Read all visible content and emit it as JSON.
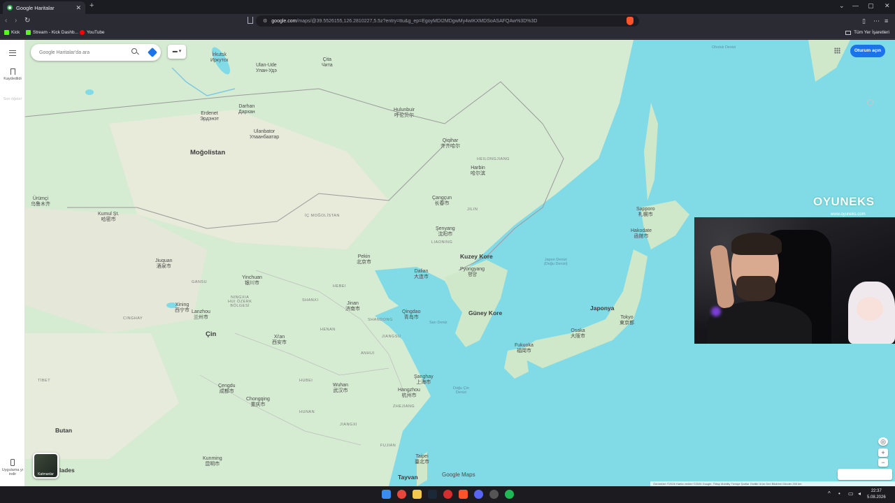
{
  "browser": {
    "tab_title": "Google Haritalar",
    "tab_close": "✕",
    "new_tab": "+",
    "url_host": "google.com",
    "url_rest": "/maps/@39.5526155,126.2810227,5.5z?entry=ttu&g_ep=EgoyMDI2MDgwMy4wIKXMDSoASAFQAw%3D%3D",
    "window_controls": [
      "⌄",
      "—",
      "▢",
      "✕"
    ],
    "bookmarks": [
      {
        "label": "Kick",
        "color": "#53fc18"
      },
      {
        "label": "Stream - Kick Dashb...",
        "color": "#53fc18"
      },
      {
        "label": "YouTube",
        "color": "#ff0000"
      }
    ],
    "all_bookmarks": "Tüm Yer İşaretleri"
  },
  "maps": {
    "search_placeholder": "Google Haritalar'da ara",
    "sign_in": "Oturum açın",
    "rail": {
      "saved": "Kaydedildi",
      "recent": "Son öğeler",
      "get_app": "Uygulama yı indir"
    },
    "layers_label": "Katmanlar",
    "logo": "Google Maps",
    "footer": "Görüntüler ©2026  Harita verileri ©2026 Google, TMap Mobility   Türkiye   Şartlar   Gizlilik   Ürün Geri Bildirimi Gönder   200 km",
    "labels": {
      "irkutsk": "İrkutsk\nИркутск",
      "ulanude": "Ulan-Ude\nУлан-Удэ",
      "chita": "Çita\nЧита",
      "hulunbuir": "Hulunbuir\n呼伦贝尔",
      "qiqihar": "Qiqihar\n齐齐哈尔",
      "harbin": "Harbin\n哈尔滨",
      "heilongjiang": "HEILONGJIANG",
      "ulaanbaatar": "Ulanbator\nУлаанбаатар",
      "mogolistan": "Moğolistan",
      "erdenet": "Erdenet\nЭрдэнэт",
      "darkhan": "Darhan\nДархан",
      "urumqi": "Ürümçi\n乌鲁木齐",
      "kumul": "Kumul Şt.\n哈密市",
      "ic_mogolistan": "İÇ MOĞOLİSTAN",
      "changchun": "Çangçun\n长春市",
      "jilin": "JILIN",
      "shenyang": "Şenyang\n沈阳市",
      "liaoning": "LIAONING",
      "kuzey_kore": "Kuzey Kore",
      "pyongyang": "Pyongyang\n평양",
      "pekin": "Pekin\n北京市",
      "dalian": "Dalian\n大连市",
      "yinchuan": "Yinchuan\n银川市",
      "jiuquan": "Jiuquan\n酒泉市",
      "gansu": "GANSU",
      "ningxia": "NINGXIA\nHUI ÖZERK\nBÖLGESİ",
      "shanxi": "SHANXI",
      "hebei": "HEBEI",
      "jinan": "Jinan\n济南市",
      "qingdao": "Qingdao\n青岛市",
      "shandong": "SHANDONG",
      "guney_kore": "Güney Kore",
      "japon_denizi": "Japon Denizi\n(Doğu Denizi)",
      "sapporo": "Sapporo\n札幌市",
      "hakodate": "Hakodate\n函館市",
      "japonya": "Japonya",
      "tokyo": "Tokyo\n東京都",
      "osaka": "Osaka\n大阪市",
      "fukuoka": "Fukuoka\n福岡市",
      "xining": "Xining\n西宁市",
      "lanzhou": "Lanzhou\n兰州市",
      "qinghai": "CINGHAY",
      "cin": "Çin",
      "xian": "Xi'an\n西安市",
      "henan": "HENAN",
      "anhui": "ANHUI",
      "jiangsu": "JIANGSU",
      "shanghai": "Şanghay\n上海市",
      "hangzhou": "Hangzhou\n杭州市",
      "zhejiang": "ZHEJIANG",
      "wuhan": "Wuhan\n武汉市",
      "hubei": "HUBEI",
      "chengdu": "Çengdu\n成都市",
      "chongqing": "Chongqing\n重庆市",
      "hunan": "HUNAN",
      "jiangxi": "JIANGXI",
      "fujian": "FUJIAN",
      "tibet": "TİBET",
      "butan": "Butan",
      "ladesh": "lades",
      "kunming": "Kunming\n昆明市",
      "taipei": "Taipei\n臺北市",
      "tayvan": "Tayvan",
      "dogu_cin": "Doğu Çin\nDenizi",
      "sari_deniz": "Sarı Deniz",
      "ohotsk": "Ohotsk Denizi"
    }
  },
  "overlay": {
    "brand": "OYUNEKS",
    "brand_url": "www.oyuneks.com"
  },
  "taskbar": {
    "time": "22:37",
    "date": "5.08.2026"
  }
}
